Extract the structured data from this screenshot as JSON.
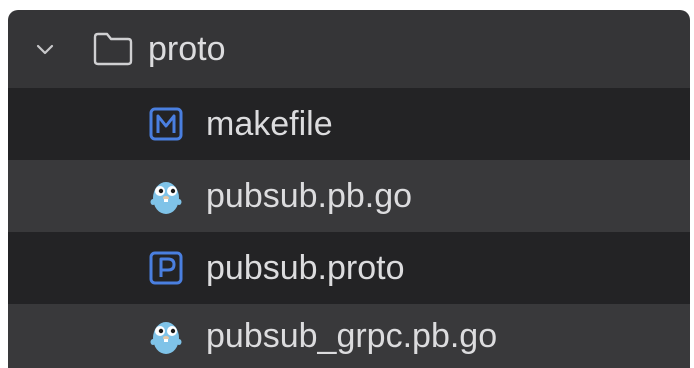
{
  "tree": {
    "folder": {
      "name": "proto",
      "expanded": true,
      "icon": "folder-outline-icon"
    },
    "files": [
      {
        "name": "makefile",
        "icon": "makefile-m-icon"
      },
      {
        "name": "pubsub.pb.go",
        "icon": "go-gopher-icon"
      },
      {
        "name": "pubsub.proto",
        "icon": "proto-p-icon"
      },
      {
        "name": "pubsub_grpc.pb.go",
        "icon": "go-gopher-icon"
      }
    ]
  },
  "colors": {
    "row_dark": "#232325",
    "row_light": "#39393b",
    "text": "#dcdcde",
    "icon_blue": "#4a7fe0",
    "gopher_blue": "#7fc3e8"
  }
}
